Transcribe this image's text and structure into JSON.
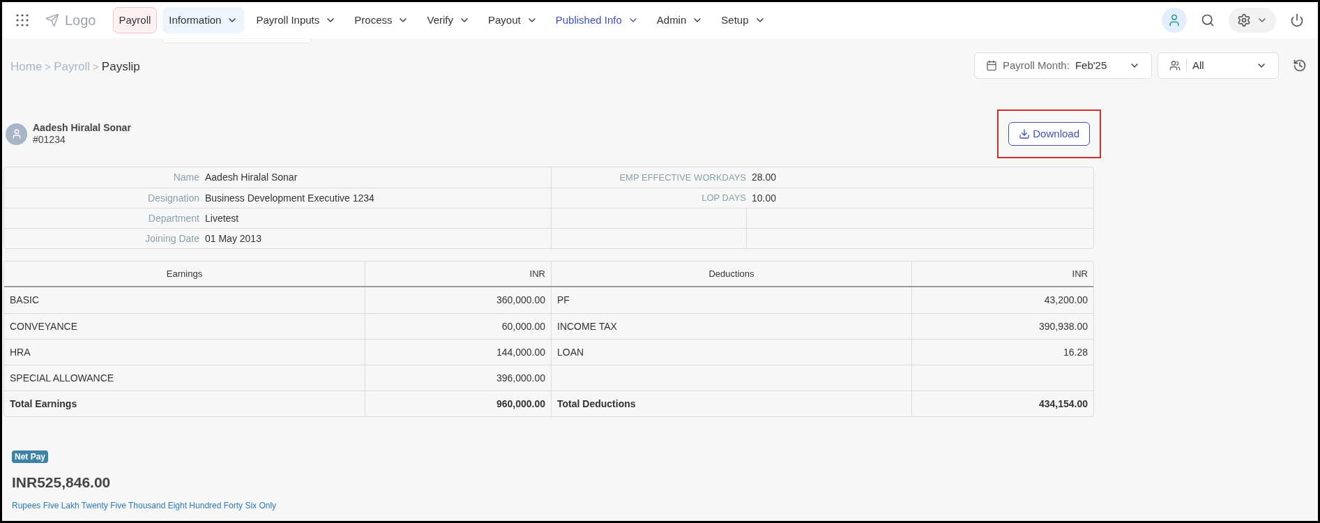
{
  "top_nav": {
    "logo": "Logo",
    "items": [
      {
        "label": "Payroll",
        "selected": true,
        "hovered": false,
        "current": false,
        "has_menu": false
      },
      {
        "label": "Information",
        "selected": false,
        "hovered": true,
        "current": false,
        "has_menu": true
      },
      {
        "label": "Payroll Inputs",
        "selected": false,
        "hovered": false,
        "current": false,
        "has_menu": true
      },
      {
        "label": "Process",
        "selected": false,
        "hovered": false,
        "current": false,
        "has_menu": true
      },
      {
        "label": "Verify",
        "selected": false,
        "hovered": false,
        "current": false,
        "has_menu": true
      },
      {
        "label": "Payout",
        "selected": false,
        "hovered": false,
        "current": false,
        "has_menu": true
      },
      {
        "label": "Published Info",
        "selected": false,
        "hovered": false,
        "current": true,
        "has_menu": true
      },
      {
        "label": "Admin",
        "selected": false,
        "hovered": false,
        "current": false,
        "has_menu": true
      },
      {
        "label": "Setup",
        "selected": false,
        "hovered": false,
        "current": false,
        "has_menu": true
      }
    ]
  },
  "breadcrumb": [
    "Home",
    ">",
    "Payroll",
    ">",
    "Payslip"
  ],
  "filters": {
    "payroll_month": {
      "label": "Payroll Month:",
      "value": "Feb'25"
    },
    "employee_group": {
      "value": "All"
    }
  },
  "employee": {
    "name": "Aadesh Hiralal Sonar",
    "id": "#01234"
  },
  "download_button": {
    "label": "Download",
    "highlighted": true
  },
  "details": [
    {
      "label": "Name",
      "value": "Aadesh Hiralal Sonar",
      "label_2": "EMP EFFECTIVE WORKDAYS",
      "value_2": "28.00"
    },
    {
      "label": "Designation",
      "value": "Business Development Executive 1234",
      "label_2": "LOP DAYS",
      "value_2": "10.00"
    },
    {
      "label": "Department",
      "value": "Livetest"
    },
    {
      "label": "Joining Date",
      "value": "01 May 2013"
    }
  ],
  "pay_table": {
    "columns": [
      "Earnings",
      "INR",
      "Deductions",
      "INR"
    ],
    "rows": [
      [
        "BASIC",
        "360,000.00",
        "PF",
        "43,200.00"
      ],
      [
        "CONVEYANCE",
        "60,000.00",
        "INCOME TAX",
        "390,938.00"
      ],
      [
        "HRA",
        "144,000.00",
        "LOAN",
        "16.28"
      ],
      [
        "SPECIAL ALLOWANCE",
        "396,000.00",
        "",
        ""
      ]
    ],
    "totals": [
      "Total Earnings",
      "960,000.00",
      "Total Deductions",
      "434,154.00"
    ]
  },
  "net_pay": {
    "badge": "Net Pay",
    "amount": "INR525,846.00",
    "in_words": "Rupees Five Lakh Twenty Five Thousand Eight Hundred Forty Six Only"
  }
}
